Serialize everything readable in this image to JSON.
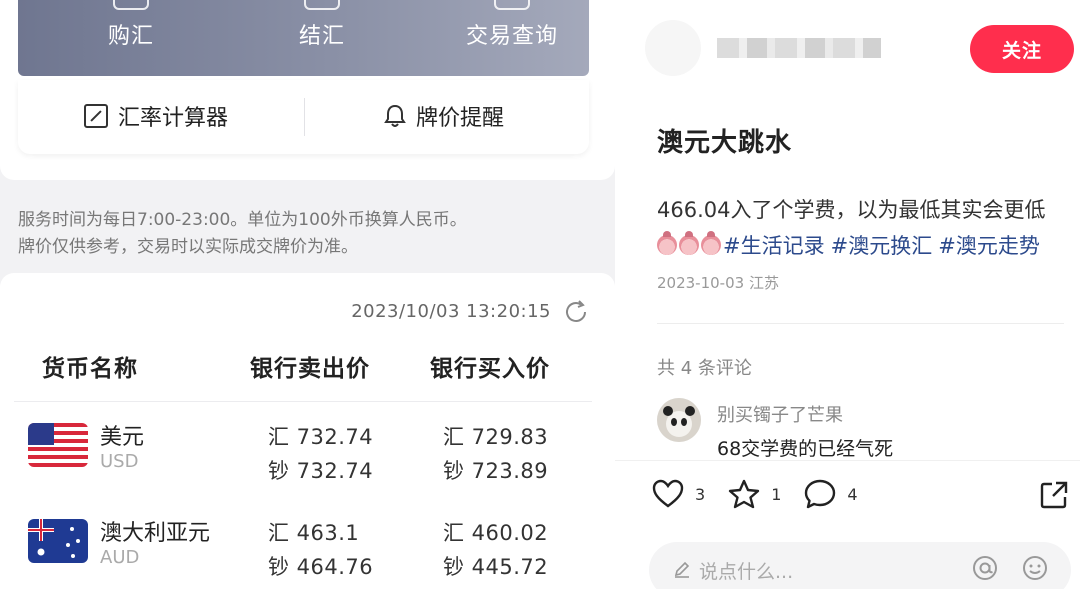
{
  "bank": {
    "banner": [
      "购汇",
      "结汇",
      "交易查询"
    ],
    "tools": {
      "calculator": "汇率计算器",
      "alert": "牌价提醒"
    },
    "notice": [
      "服务时间为每日7:00-23:00。单位为100外币换算人民币。",
      "牌价仅供参考，交易时以实际成交牌价为准。"
    ],
    "timestamp": "2023/10/03 13:20:15",
    "headers": [
      "货币名称",
      "银行卖出价",
      "银行买入价"
    ],
    "rows": [
      {
        "name": "美元",
        "code": "USD",
        "sell_wire": "汇 732.74",
        "sell_cash": "钞 732.74",
        "buy_wire": "汇 729.83",
        "buy_cash": "钞 723.89"
      },
      {
        "name": "澳大利亚元",
        "code": "AUD",
        "sell_wire": "汇 463.1",
        "sell_cash": "钞 464.76",
        "buy_wire": "汇 460.02",
        "buy_cash": "钞 445.72"
      }
    ]
  },
  "post": {
    "follow_label": "关注",
    "title": "澳元大跳水",
    "body_line1": "466.04入了个学费，以为最低其实会更低",
    "tags": [
      "#生活记录",
      "#澳元换汇",
      "#澳元走势"
    ],
    "meta": "2023-10-03 江苏",
    "comment_count": "共 4 条评论",
    "comment": {
      "name": "别买镯子了芒果",
      "text": "68交学费的已经气死"
    },
    "actions": {
      "likes": "3",
      "stars": "1",
      "comments": "4"
    },
    "input_placeholder": "说点什么..."
  },
  "colors": {
    "follow": "#ff2e4d",
    "tag": "#2c4a8c",
    "banner": "#7a8098"
  }
}
